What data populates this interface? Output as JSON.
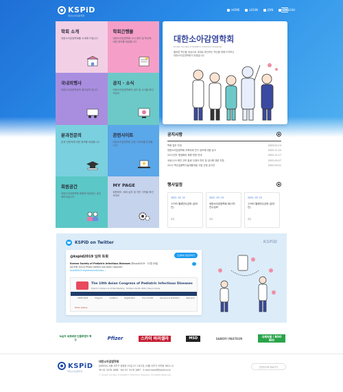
{
  "header": {
    "logo_text": "KSPiD",
    "logo_sub": "대한소아감염학회",
    "nav": [
      {
        "label": "HOME",
        "icon": "home-icon"
      },
      {
        "label": "LOGIN",
        "icon": "login-icon"
      },
      {
        "label": "JOIN",
        "icon": "join-icon"
      },
      {
        "label": "ENGLISH",
        "icon": "globe-icon"
      }
    ]
  },
  "tiles": [
    {
      "title": "학회 소개",
      "desc": "대한소아감염학회를 소개해 드립니다",
      "icon": "building-icon",
      "color": "#f3cfe6"
    },
    {
      "title": "학회간행물",
      "desc": "대한소아감염학회 소식 정보 및 학교에 대한 정보를 제공합니다",
      "icon": "book-icon",
      "color": "#f59fc8"
    },
    {
      "title": "국내외행사",
      "desc": "대한소아감염학회의 행사정보 입니다",
      "icon": "presentation-icon",
      "color": "#a98ee0"
    },
    {
      "title": "공지 · 소식",
      "desc": "대한소아감염학회의 공지 및 소식을 확인하세요",
      "icon": "monitor-icon",
      "color": "#6cc9c8"
    },
    {
      "title": "분과전문의",
      "desc": "분과 전문의에 대한 정보를 제공합니다",
      "icon": "graduation-icon",
      "color": "#7ad0de"
    },
    {
      "title": "관련사이트",
      "desc": "대한소아감염학회 관련 사이트를 안내합니다",
      "icon": "laptop-icon",
      "color": "#5aa7e9"
    },
    {
      "title": "회원공간",
      "desc": "대한소아감염학회 회원께 제공되는 공간 페이지입니다",
      "icon": "people-icon",
      "color": "#5bc7c6"
    },
    {
      "title": "MY PAGE",
      "desc": "회원정보, 회비 납부 및 개인 이력을 확인하세요",
      "icon": "gear-icon",
      "color": "#c6d3ec"
    }
  ],
  "banner": {
    "title": "대한소아감염학회",
    "subtitle": "Korean Society of Pediatric Infectious Diseases",
    "text": "올바른 백신을 세상으로 세계로 확산하는 백신을 위해 도약하는 대한소아감염학회가 되겠습니다"
  },
  "notice": {
    "title": "공지사항",
    "items": [
      {
        "title": "학회 업무 안내",
        "date": "2023.02.13"
      },
      {
        "title": "대한소아감염학회 국책과제 연구 공모에 대한 공고",
        "date": "2022.11.23"
      },
      {
        "title": "2022년도 평생회비 회원 변경 안내",
        "date": "2022.11.17"
      },
      {
        "title": "코로나19 확진 산모 출생 신생아 관리 및 검사에 대한 지침",
        "date": "2022.09.27"
      },
      {
        "title": "2022 백신실용학기술제품개발 사업 신청 공고안",
        "date": "2022.09.21"
      }
    ]
  },
  "events": {
    "title": "행사일정",
    "items": [
      {
        "date": "2022. 02. 22",
        "title": "175차 월례연수강좌 (온라인)",
        "status": "종료"
      },
      {
        "date": "2022. 03. 19",
        "title": "대한소아감염학회 제23차 연수강좌",
        "status": "종료"
      },
      {
        "date": "2022. 03. 22",
        "title": "176차 월례연수강좌 (온라인)",
        "status": "종료"
      }
    ]
  },
  "twitter": {
    "title": "KSPiD on Twitter",
    "brand": "KSPiD",
    "card_title": "@kspid2019 님의 트윗",
    "follow_label": "트윗에서 팔로우하기",
    "post_author": "Korean Society of Pediatric Infectious Diseases",
    "post_handle": "@kspid2019 · 11월 20일",
    "post_text": "[ACPID 2022] Photo Gallery has been Opened!",
    "post_link": "acpid2022.org/resource/resou...",
    "image_title": "The 10th Asian Congress of Pediatric Infectious Diseases",
    "image_sub": "Hybrid in Person & Virtual Meeting · October 26-28, 2022 | Seoul, Korea",
    "image_nav": [
      "ACPID 2022",
      "Program",
      "Invitation",
      "Registration",
      "Tour & Hotel",
      "Sponsors & Exhibitors",
      "Resource"
    ],
    "image_footer": "Photo Gallery"
  },
  "partners": [
    {
      "label": "녹십자 세포배양 인플루엔자 백신",
      "name": "partner-gc"
    },
    {
      "label": "Pfizer",
      "name": "partner-pfizer"
    },
    {
      "label": "스카이 바리셀라",
      "name": "partner-sky"
    },
    {
      "label": "MSD",
      "name": "partner-msd"
    },
    {
      "label": "SANOFI PASTEUR",
      "name": "partner-sanofi"
    },
    {
      "label": "국제약품 / BOO BIO",
      "name": "partner-boo"
    }
  ],
  "footer": {
    "org": "대한소아감염학회",
    "address": "[06654] 서울 서초구 효령로 55길 22 1101호 (서울 서초구 서초동 1601-2)",
    "contact": "Tel 02 3476 1668 · Fax 02 3476 1667 · E-mail kspid@kspid.or.kr",
    "copyright": "ⓒ Korean Society of Pediatric Infectious Diseases. All Rights Reserved.",
    "related_label": "관련사이트 바로가기"
  }
}
